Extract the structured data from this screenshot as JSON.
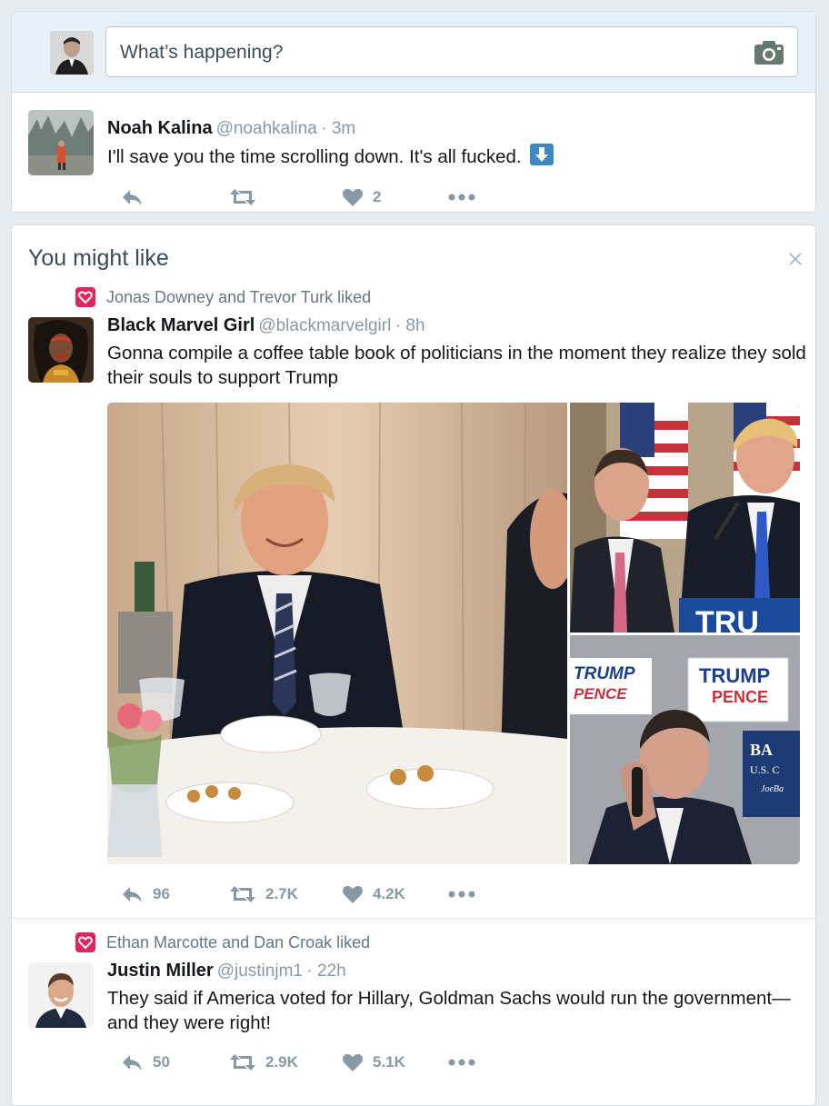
{
  "composer": {
    "placeholder": "What’s happening?",
    "camera_icon": "camera-icon"
  },
  "tweets": [
    {
      "name": "Noah Kalina",
      "handle": "@noahkalina",
      "time": "· 3m",
      "text": "I'll save you the time scrolling down. It's all fucked.",
      "emoji": "down-arrow-emoji",
      "reply_count": "",
      "retweet_count": "",
      "like_count": "2"
    }
  ],
  "recommendations": {
    "title": "You might like",
    "close_icon": "close-icon",
    "items": [
      {
        "liked_by": "Jonas Downey and Trevor Turk liked",
        "name": "Black Marvel Girl",
        "handle": "@blackmarvelgirl",
        "time": "· 8h",
        "text": "Gonna compile a coffee table book of politicians in the moment they realize they sold their souls to support Trump",
        "photo_signs": [
          "TRUMP",
          "PENCE",
          "TRUMP",
          "PENCE",
          "BA",
          "U.S. C",
          "JoeBa",
          "TRU"
        ],
        "reply_count": "96",
        "retweet_count": "2.7K",
        "like_count": "4.2K"
      },
      {
        "liked_by": "Ethan Marcotte and Dan Croak liked",
        "name": "Justin Miller",
        "handle": "@justinjm1",
        "time": "· 22h",
        "text": "They said if America voted for Hillary, Goldman Sachs would run the government—and they were right!",
        "reply_count": "50",
        "retweet_count": "2.9K",
        "like_count": "5.1K"
      }
    ]
  },
  "colors": {
    "background": "#e6ecf0",
    "action_gray": "#8899a6",
    "like_red": "#e0245e",
    "emoji_blue": "#3b88c3"
  }
}
